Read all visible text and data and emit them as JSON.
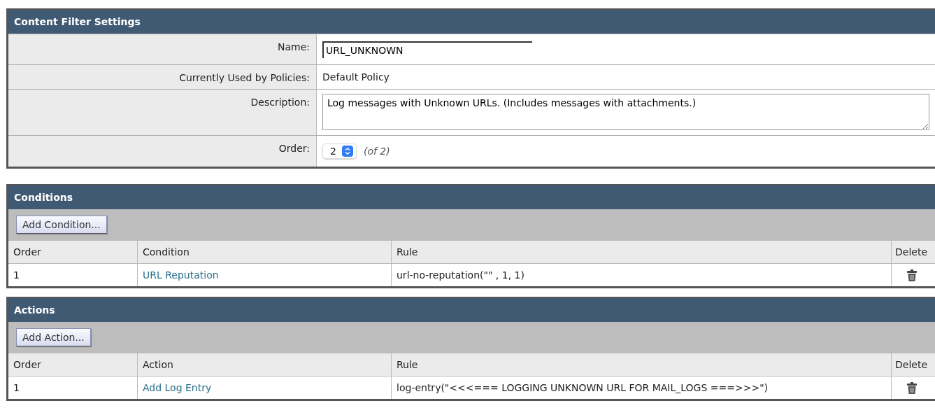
{
  "settings": {
    "title": "Content Filter Settings",
    "fields": [
      {
        "kind": "text-input",
        "label": "Name:",
        "value": "URL_UNKNOWN"
      },
      {
        "kind": "static",
        "label": "Currently Used by Policies:",
        "value": "Default Policy"
      },
      {
        "kind": "textarea",
        "label": "Description:",
        "value": "Log messages with Unknown URLs. (Includes messages with attachments.)"
      },
      {
        "kind": "select",
        "label": "Order:",
        "value": "2",
        "note": "(of 2)"
      }
    ]
  },
  "conditions": {
    "title": "Conditions",
    "add_button": "Add Condition...",
    "columns": [
      "Order",
      "Condition",
      "Rule",
      "Delete"
    ],
    "rows": [
      {
        "order": "1",
        "name": "URL Reputation",
        "rule": "url-no-reputation(\"\" , 1, 1)"
      }
    ]
  },
  "actions": {
    "title": "Actions",
    "add_button": "Add Action...",
    "columns": [
      "Order",
      "Action",
      "Rule",
      "Delete"
    ],
    "rows": [
      {
        "order": "1",
        "name": "Add Log Entry",
        "rule": "log-entry(\"<<<=== LOGGING UNKNOWN URL FOR MAIL_LOGS ===>>>\")"
      }
    ]
  }
}
